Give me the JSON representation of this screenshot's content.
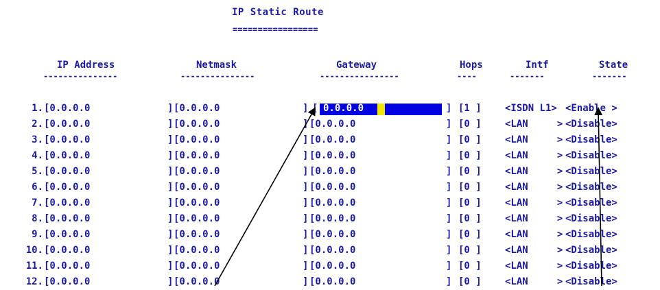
{
  "screen": {
    "title": "IP Static Route",
    "title_underline": "================="
  },
  "columns": {
    "ip": "IP Address",
    "netmask": "Netmask",
    "gateway": "Gateway",
    "hops": "Hops",
    "intf": "Intf",
    "state": "State"
  },
  "dashes": {
    "ip": "---------------",
    "netmask": "---------------",
    "gateway": "----------------",
    "hops": "----",
    "intf": "-------",
    "state": "-------"
  },
  "rows": [
    {
      "num": "1.",
      "ip": "[0.0.0.0",
      "ip_close": "]",
      "netmask": "[0.0.0.0",
      "nm_close": "]",
      "gateway": "[0.0.0.0",
      "gw_close": "]",
      "hops": "[1 ]",
      "intf": "<ISDN L1>",
      "state": "<Enable >"
    },
    {
      "num": "2.",
      "ip": "[0.0.0.0",
      "ip_close": "]",
      "netmask": "[0.0.0.0",
      "nm_close": "]",
      "gateway": "[0.0.0.0",
      "gw_close": "]",
      "hops": "[0 ]",
      "intf": "<LAN     >",
      "state": "<Disable>"
    },
    {
      "num": "3.",
      "ip": "[0.0.0.0",
      "ip_close": "]",
      "netmask": "[0.0.0.0",
      "nm_close": "]",
      "gateway": "[0.0.0.0",
      "gw_close": "]",
      "hops": "[0 ]",
      "intf": "<LAN     >",
      "state": "<Disable>"
    },
    {
      "num": "4.",
      "ip": "[0.0.0.0",
      "ip_close": "]",
      "netmask": "[0.0.0.0",
      "nm_close": "]",
      "gateway": "[0.0.0.0",
      "gw_close": "]",
      "hops": "[0 ]",
      "intf": "<LAN     >",
      "state": "<Disable>"
    },
    {
      "num": "5.",
      "ip": "[0.0.0.0",
      "ip_close": "]",
      "netmask": "[0.0.0.0",
      "nm_close": "]",
      "gateway": "[0.0.0.0",
      "gw_close": "]",
      "hops": "[0 ]",
      "intf": "<LAN     >",
      "state": "<Disable>"
    },
    {
      "num": "6.",
      "ip": "[0.0.0.0",
      "ip_close": "]",
      "netmask": "[0.0.0.0",
      "nm_close": "]",
      "gateway": "[0.0.0.0",
      "gw_close": "]",
      "hops": "[0 ]",
      "intf": "<LAN     >",
      "state": "<Disable>"
    },
    {
      "num": "7.",
      "ip": "[0.0.0.0",
      "ip_close": "]",
      "netmask": "[0.0.0.0",
      "nm_close": "]",
      "gateway": "[0.0.0.0",
      "gw_close": "]",
      "hops": "[0 ]",
      "intf": "<LAN     >",
      "state": "<Disable>"
    },
    {
      "num": "8.",
      "ip": "[0.0.0.0",
      "ip_close": "]",
      "netmask": "[0.0.0.0",
      "nm_close": "]",
      "gateway": "[0.0.0.0",
      "gw_close": "]",
      "hops": "[0 ]",
      "intf": "<LAN     >",
      "state": "<Disable>"
    },
    {
      "num": "9.",
      "ip": "[0.0.0.0",
      "ip_close": "]",
      "netmask": "[0.0.0.0",
      "nm_close": "]",
      "gateway": "[0.0.0.0",
      "gw_close": "]",
      "hops": "[0 ]",
      "intf": "<LAN     >",
      "state": "<Disable>"
    },
    {
      "num": "10.",
      "ip": "[0.0.0.0",
      "ip_close": "]",
      "netmask": "[0.0.0.0",
      "nm_close": "]",
      "gateway": "[0.0.0.0",
      "gw_close": "]",
      "hops": "[0 ]",
      "intf": "<LAN     >",
      "state": "<Disable>"
    },
    {
      "num": "11.",
      "ip": "[0.0.0.0",
      "ip_close": "]",
      "netmask": "[0.0.0.0",
      "nm_close": "]",
      "gateway": "[0.0.0.0",
      "gw_close": "]",
      "hops": "[0 ]",
      "intf": "<LAN     >",
      "state": "<Disable>"
    },
    {
      "num": "12.",
      "ip": "[0.0.0.0",
      "ip_close": "]",
      "netmask": "[0.0.0.0",
      "nm_close": "]",
      "gateway": "[0.0.0.0",
      "gw_close": "]",
      "hops": "[0 ]",
      "intf": "<LAN     >",
      "state": "<Disable>"
    }
  ],
  "colors": {
    "text": "#1a1aa8",
    "selection": "#0000e0",
    "cursor": "#f4e500",
    "background": "#ffffff",
    "annotation": "#000000"
  }
}
